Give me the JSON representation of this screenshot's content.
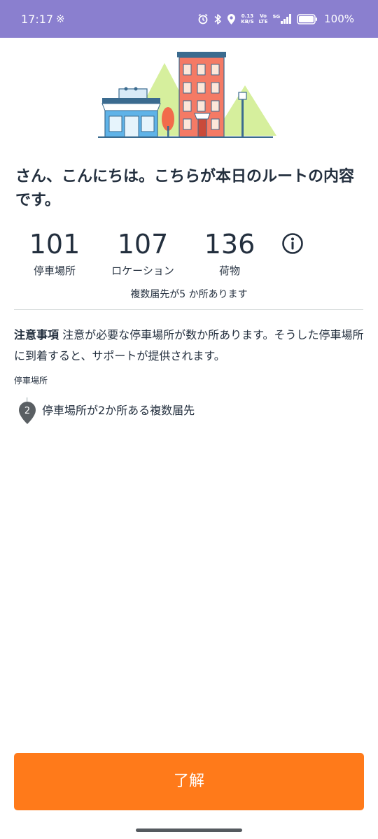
{
  "status_bar": {
    "time": "17:17",
    "extra": "※",
    "network_speed": "0.13",
    "network_speed_unit": "KB/S",
    "volte_top": "Vo",
    "volte_bottom": "LTE",
    "signal_label": "5G",
    "battery": "100%",
    "background": "#8a7fcf",
    "icons": [
      "alarm-icon",
      "bluetooth-icon",
      "location-icon",
      "signal-icon",
      "battery-icon"
    ]
  },
  "greeting": "さん、こんにちは。こちらが本日のルートの内容です。",
  "stats": {
    "stops_value": "101",
    "stops_label": "停車場所",
    "locations_value": "107",
    "locations_label": "ロケーション",
    "packages_value": "136",
    "packages_label": "荷物",
    "info_icon": "info-icon"
  },
  "multi_note": "複数届先が5 か所あります",
  "notice": {
    "title": "注意事項",
    "body": " 注意が必要な停車場所が数か所あります。そうした停車場所に到着すると、サポートが提供されます。"
  },
  "stop_header": "停車場所",
  "stop_item": {
    "pin_number": "2",
    "text": "停車場所が2か所ある複数届先"
  },
  "button": {
    "label": "了解",
    "color": "#ff7a1a"
  }
}
